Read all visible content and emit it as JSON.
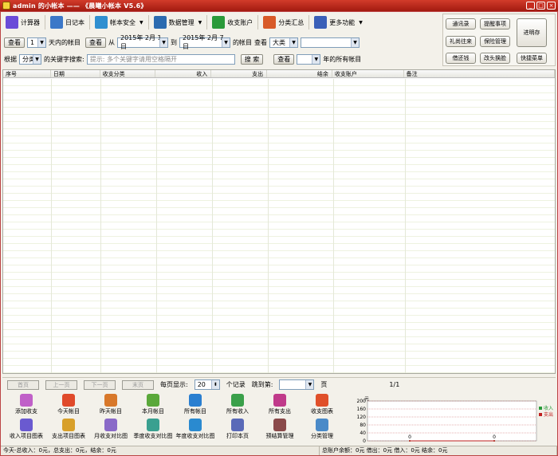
{
  "window": {
    "title": "admin 的小帐本 —— 《晨曦小帐本 V5.6》",
    "controls": [
      "_",
      "□",
      "×"
    ]
  },
  "toolbar": [
    {
      "name": "calculator",
      "label": "计算器",
      "color": "#6a4bd8",
      "dropdown": false
    },
    {
      "name": "diary",
      "label": "日记本",
      "color": "#3c78c8",
      "dropdown": false
    },
    {
      "name": "account-security",
      "label": "帐本安全",
      "color": "#2f8fd0",
      "dropdown": true
    },
    {
      "name": "data-manage",
      "label": "数据管理",
      "color": "#2b6bb0",
      "dropdown": true
    },
    {
      "name": "accounts",
      "label": "收支账户",
      "color": "#2a9a3a",
      "dropdown": false
    },
    {
      "name": "category-summary",
      "label": "分类汇总",
      "color": "#d85a28",
      "dropdown": false
    },
    {
      "name": "more",
      "label": "更多功能",
      "color": "#3a5fb8",
      "dropdown": true
    }
  ],
  "filters": {
    "row1": {
      "query_label": "查看",
      "days_value": "1",
      "days_suffix": "天内的帐目",
      "query2_label": "查看",
      "from_label": "从",
      "from_date": "2015年 2月 1日",
      "to_label": "到",
      "to_date": "2015年 2月 7日",
      "suffix": "的帐目",
      "view_label": "查看",
      "type_value": "大类",
      "sub_value": ""
    },
    "row2": {
      "by_label": "根据",
      "by_value": "分类",
      "keyword_label": "的关键字搜索:",
      "keyword_placeholder": "提示: 多个关键字请用空格隔开",
      "search_label": "搜 索",
      "query_label": "查看",
      "year_value": "",
      "year_suffix": "年的所有帐目"
    }
  },
  "right_buttons": [
    {
      "name": "contacts",
      "label": "通讯录"
    },
    {
      "name": "reminders",
      "label": "提醒事项"
    },
    {
      "name": "gift-book",
      "label": "礼尚往来"
    },
    {
      "name": "insurance",
      "label": "保险管理"
    },
    {
      "name": "debt",
      "label": "借还钱"
    },
    {
      "name": "exchange",
      "label": "改头换脸"
    },
    {
      "name": "wallet",
      "label": "进明存"
    },
    {
      "name": "shortcut-menu",
      "label": "快捷菜单"
    }
  ],
  "table": {
    "columns": [
      "序号",
      "日期",
      "收支分类",
      "收入",
      "支出",
      "结余",
      "收支账户",
      "备注"
    ]
  },
  "pager": {
    "first": "首页",
    "prev": "上一页",
    "next": "下一页",
    "last": "末页",
    "per_page_label": "每页显示:",
    "per_page_value": "20",
    "per_page_suffix": "个记录",
    "jump_label": "跳到第:",
    "jump_value": "",
    "jump_suffix": "页",
    "page_info": "1/1"
  },
  "actions": [
    {
      "name": "add-income-expense",
      "label": "添加收支",
      "color": "#c060c8"
    },
    {
      "name": "today-records",
      "label": "今天帐目",
      "color": "#e04a2a"
    },
    {
      "name": "yesterday-records",
      "label": "昨天帐目",
      "color": "#d8782a"
    },
    {
      "name": "month-records",
      "label": "本月帐目",
      "color": "#5aa83a"
    },
    {
      "name": "all-records",
      "label": "所有帐目",
      "color": "#2a7fd0"
    },
    {
      "name": "all-income",
      "label": "所有收入",
      "color": "#3aa04a"
    },
    {
      "name": "all-expense",
      "label": "所有支出",
      "color": "#c03a8a"
    },
    {
      "name": "income-expense-chart",
      "label": "收支图表",
      "color": "#e0502a"
    },
    {
      "name": "income-item-chart",
      "label": "收入项目图表",
      "color": "#6a5ad0"
    },
    {
      "name": "expense-item-chart",
      "label": "支出项目图表",
      "color": "#d8a02a"
    },
    {
      "name": "monthly-compare",
      "label": "月收支对比图",
      "color": "#8a6ac8"
    },
    {
      "name": "quarterly-compare",
      "label": "季度收支对比图",
      "color": "#3aa090"
    },
    {
      "name": "yearly-compare",
      "label": "年度收支对比图",
      "color": "#2a8ad0"
    },
    {
      "name": "print-page",
      "label": "打印本页",
      "color": "#5a6ab8"
    },
    {
      "name": "budget-manage",
      "label": "预结算管理",
      "color": "#8a4a4a"
    },
    {
      "name": "category-manage",
      "label": "分类管理",
      "color": "#4a8ac8"
    }
  ],
  "chart_data": {
    "type": "line",
    "ylabel": "元",
    "ylim": [
      0,
      200
    ],
    "yticks": [
      0,
      40,
      80,
      120,
      160,
      200
    ],
    "series": [
      {
        "name": "收入",
        "color": "#2a9a3a",
        "values": [
          0,
          0
        ]
      },
      {
        "name": "支出",
        "color": "#c02020",
        "values": [
          0,
          0
        ]
      }
    ],
    "data_labels": [
      "0",
      "0"
    ]
  },
  "status": {
    "left": "今天-总收入：0元，总支出：0元，结余：0元",
    "right": "总账户余额：0元 借出：0元 借入：0元 结余：0元"
  }
}
